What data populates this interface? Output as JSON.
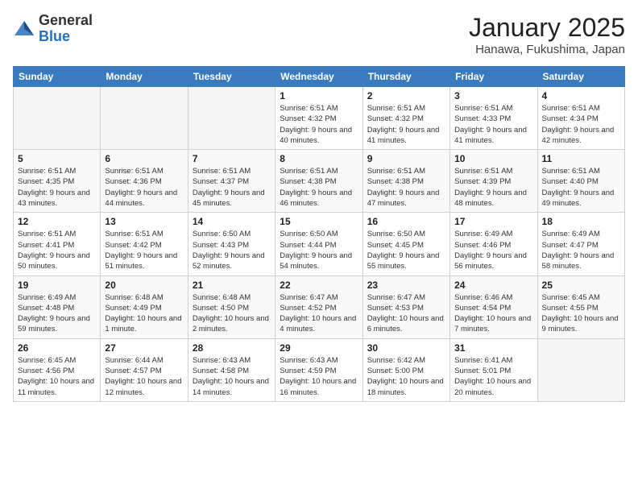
{
  "header": {
    "logo_general": "General",
    "logo_blue": "Blue",
    "month": "January 2025",
    "location": "Hanawa, Fukushima, Japan"
  },
  "days_of_week": [
    "Sunday",
    "Monday",
    "Tuesday",
    "Wednesday",
    "Thursday",
    "Friday",
    "Saturday"
  ],
  "weeks": [
    [
      {
        "day": "",
        "info": ""
      },
      {
        "day": "",
        "info": ""
      },
      {
        "day": "",
        "info": ""
      },
      {
        "day": "1",
        "info": "Sunrise: 6:51 AM\nSunset: 4:32 PM\nDaylight: 9 hours\nand 40 minutes."
      },
      {
        "day": "2",
        "info": "Sunrise: 6:51 AM\nSunset: 4:32 PM\nDaylight: 9 hours\nand 41 minutes."
      },
      {
        "day": "3",
        "info": "Sunrise: 6:51 AM\nSunset: 4:33 PM\nDaylight: 9 hours\nand 41 minutes."
      },
      {
        "day": "4",
        "info": "Sunrise: 6:51 AM\nSunset: 4:34 PM\nDaylight: 9 hours\nand 42 minutes."
      }
    ],
    [
      {
        "day": "5",
        "info": "Sunrise: 6:51 AM\nSunset: 4:35 PM\nDaylight: 9 hours\nand 43 minutes."
      },
      {
        "day": "6",
        "info": "Sunrise: 6:51 AM\nSunset: 4:36 PM\nDaylight: 9 hours\nand 44 minutes."
      },
      {
        "day": "7",
        "info": "Sunrise: 6:51 AM\nSunset: 4:37 PM\nDaylight: 9 hours\nand 45 minutes."
      },
      {
        "day": "8",
        "info": "Sunrise: 6:51 AM\nSunset: 4:38 PM\nDaylight: 9 hours\nand 46 minutes."
      },
      {
        "day": "9",
        "info": "Sunrise: 6:51 AM\nSunset: 4:38 PM\nDaylight: 9 hours\nand 47 minutes."
      },
      {
        "day": "10",
        "info": "Sunrise: 6:51 AM\nSunset: 4:39 PM\nDaylight: 9 hours\nand 48 minutes."
      },
      {
        "day": "11",
        "info": "Sunrise: 6:51 AM\nSunset: 4:40 PM\nDaylight: 9 hours\nand 49 minutes."
      }
    ],
    [
      {
        "day": "12",
        "info": "Sunrise: 6:51 AM\nSunset: 4:41 PM\nDaylight: 9 hours\nand 50 minutes."
      },
      {
        "day": "13",
        "info": "Sunrise: 6:51 AM\nSunset: 4:42 PM\nDaylight: 9 hours\nand 51 minutes."
      },
      {
        "day": "14",
        "info": "Sunrise: 6:50 AM\nSunset: 4:43 PM\nDaylight: 9 hours\nand 52 minutes."
      },
      {
        "day": "15",
        "info": "Sunrise: 6:50 AM\nSunset: 4:44 PM\nDaylight: 9 hours\nand 54 minutes."
      },
      {
        "day": "16",
        "info": "Sunrise: 6:50 AM\nSunset: 4:45 PM\nDaylight: 9 hours\nand 55 minutes."
      },
      {
        "day": "17",
        "info": "Sunrise: 6:49 AM\nSunset: 4:46 PM\nDaylight: 9 hours\nand 56 minutes."
      },
      {
        "day": "18",
        "info": "Sunrise: 6:49 AM\nSunset: 4:47 PM\nDaylight: 9 hours\nand 58 minutes."
      }
    ],
    [
      {
        "day": "19",
        "info": "Sunrise: 6:49 AM\nSunset: 4:48 PM\nDaylight: 9 hours\nand 59 minutes."
      },
      {
        "day": "20",
        "info": "Sunrise: 6:48 AM\nSunset: 4:49 PM\nDaylight: 10 hours\nand 1 minute."
      },
      {
        "day": "21",
        "info": "Sunrise: 6:48 AM\nSunset: 4:50 PM\nDaylight: 10 hours\nand 2 minutes."
      },
      {
        "day": "22",
        "info": "Sunrise: 6:47 AM\nSunset: 4:52 PM\nDaylight: 10 hours\nand 4 minutes."
      },
      {
        "day": "23",
        "info": "Sunrise: 6:47 AM\nSunset: 4:53 PM\nDaylight: 10 hours\nand 6 minutes."
      },
      {
        "day": "24",
        "info": "Sunrise: 6:46 AM\nSunset: 4:54 PM\nDaylight: 10 hours\nand 7 minutes."
      },
      {
        "day": "25",
        "info": "Sunrise: 6:45 AM\nSunset: 4:55 PM\nDaylight: 10 hours\nand 9 minutes."
      }
    ],
    [
      {
        "day": "26",
        "info": "Sunrise: 6:45 AM\nSunset: 4:56 PM\nDaylight: 10 hours\nand 11 minutes."
      },
      {
        "day": "27",
        "info": "Sunrise: 6:44 AM\nSunset: 4:57 PM\nDaylight: 10 hours\nand 12 minutes."
      },
      {
        "day": "28",
        "info": "Sunrise: 6:43 AM\nSunset: 4:58 PM\nDaylight: 10 hours\nand 14 minutes."
      },
      {
        "day": "29",
        "info": "Sunrise: 6:43 AM\nSunset: 4:59 PM\nDaylight: 10 hours\nand 16 minutes."
      },
      {
        "day": "30",
        "info": "Sunrise: 6:42 AM\nSunset: 5:00 PM\nDaylight: 10 hours\nand 18 minutes."
      },
      {
        "day": "31",
        "info": "Sunrise: 6:41 AM\nSunset: 5:01 PM\nDaylight: 10 hours\nand 20 minutes."
      },
      {
        "day": "",
        "info": ""
      }
    ]
  ]
}
